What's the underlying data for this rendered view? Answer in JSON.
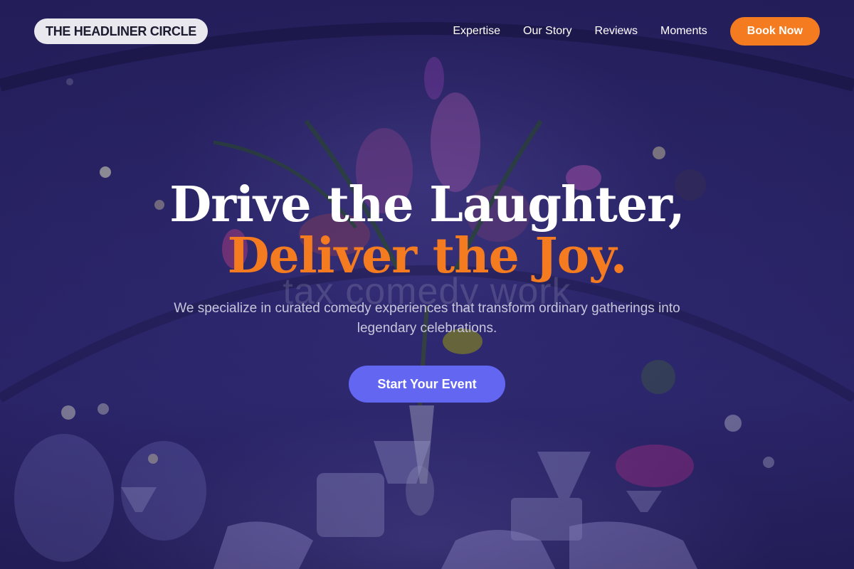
{
  "brand": {
    "name": "THE HEADLINER CIRCLE"
  },
  "nav": {
    "links": [
      "Expertise",
      "Our Story",
      "Reviews",
      "Moments"
    ],
    "book_label": "Book Now"
  },
  "hero": {
    "headline_line1": "Drive the Laughter,",
    "headline_line2": "Deliver the Joy.",
    "watermark": "tax comedy work",
    "subtitle": "We specialize in curated comedy experiences that transform ordinary gatherings into legendary celebrations.",
    "cta_label": "Start Your Event"
  },
  "colors": {
    "accent": "#f47b20",
    "cta": "#6366f1",
    "background": "#2a2466"
  }
}
